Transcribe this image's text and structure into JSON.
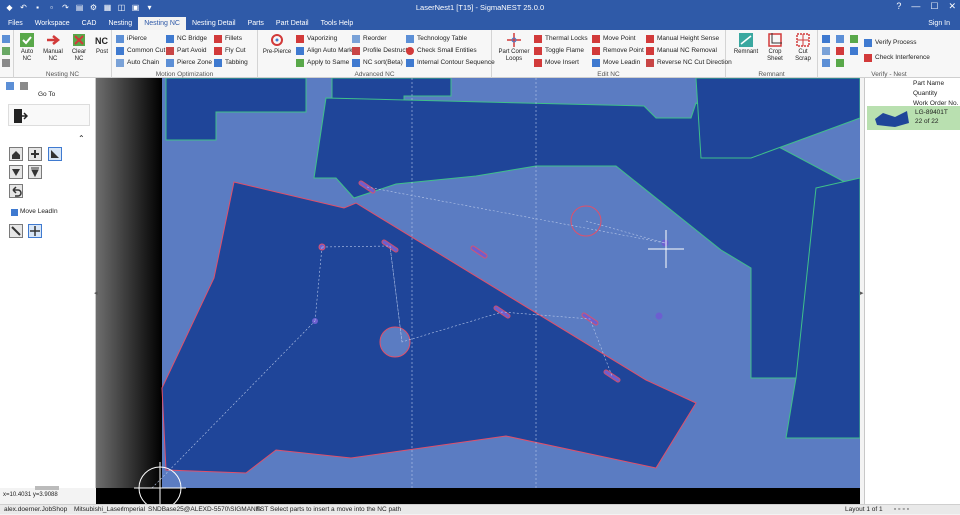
{
  "window": {
    "title": "LaserNest1 [T15] - SigmaNEST 25.0.0",
    "sign_in": "Sign In"
  },
  "menu": {
    "tabs": [
      "Files",
      "Workspace",
      "CAD",
      "Nesting",
      "Nesting NC",
      "Nesting Detail",
      "Parts",
      "Part Detail",
      "Tools Help"
    ],
    "active": "Nesting NC"
  },
  "ribbon": {
    "nesting_nc": {
      "label": "Nesting NC",
      "auto_nc": "Auto NC",
      "manual_nc": "Manual NC",
      "clear_nc": "Clear NC",
      "post": "Post"
    },
    "motion_opt": {
      "label": "Motion Optimization",
      "ipierce": "iPierce",
      "common_cut": "Common Cut",
      "auto_chain": "Auto Chain",
      "nc_bridge": "NC Bridge",
      "part_avoid": "Part Avoid",
      "pierce_zone": "Pierce Zone",
      "fillets": "Fillets",
      "fly_cut": "Fly Cut",
      "tabbing": "Tabbing"
    },
    "advanced_nc": {
      "label": "Advanced NC",
      "pre_pierce": "Pre-Pierce",
      "vaporizing": "Vaporizing",
      "align_auto_mark": "Align Auto Mark",
      "apply_to_same": "Apply to Same",
      "reorder": "Reorder",
      "profile_destruct": "Profile Destruct",
      "nc_sort": "NC sort(Beta)",
      "technology_table": "Technology Table",
      "check_small": "Check Small Entities",
      "internal_contour": "Internal Contour Sequence"
    },
    "edit_nc": {
      "label": "Edit NC",
      "part_corner_loops": "Part Corner Loops",
      "thermal_locks": "Thermal Locks",
      "toggle_flame": "Toggle Flame",
      "move_insert": "Move Insert",
      "move_point": "Move Point",
      "remove_point": "Remove Point",
      "move_leadin": "Move Leadin",
      "manual_height": "Manual Height Sense",
      "manual_nc_removal": "Manual NC Removal",
      "reverse_nc": "Reverse NC Cut Direction"
    },
    "remnant": {
      "label": "Remnant",
      "remnant": "Remnant",
      "crop_sheet": "Crop Sheet",
      "cut_scrap": "Cut Scrap"
    },
    "verify": {
      "label": "Verify - Nest",
      "verify_process": "Verify Process",
      "check_interference": "Check Interference"
    }
  },
  "left_panel": {
    "go_to": "Go To",
    "move_leadin": "Move LeadIn",
    "coords": "x=10.4031 y=3.9088"
  },
  "right_panel": {
    "headers": [
      "Part Name",
      "Quantity",
      "Work Order No."
    ],
    "part_name": "LG-89401T",
    "quantity": "22 of 22"
  },
  "status": {
    "user": "alex.doerner.JobShop",
    "machine": "Mitsubishi_Laser",
    "units": "Imperial",
    "db": "SNDBase25@ALEXD-5570\\SIGMANEST",
    "hint": "Select parts to insert a move into the NC path",
    "layout": "Layout 1 of 1"
  },
  "colors": {
    "titlebar": "#2f5aa8",
    "sheet_bg": "#5b7cc2",
    "part_fill": "#1f4599",
    "part_outline_red": "#e0506a",
    "part_outline_green": "#3fc08a"
  }
}
